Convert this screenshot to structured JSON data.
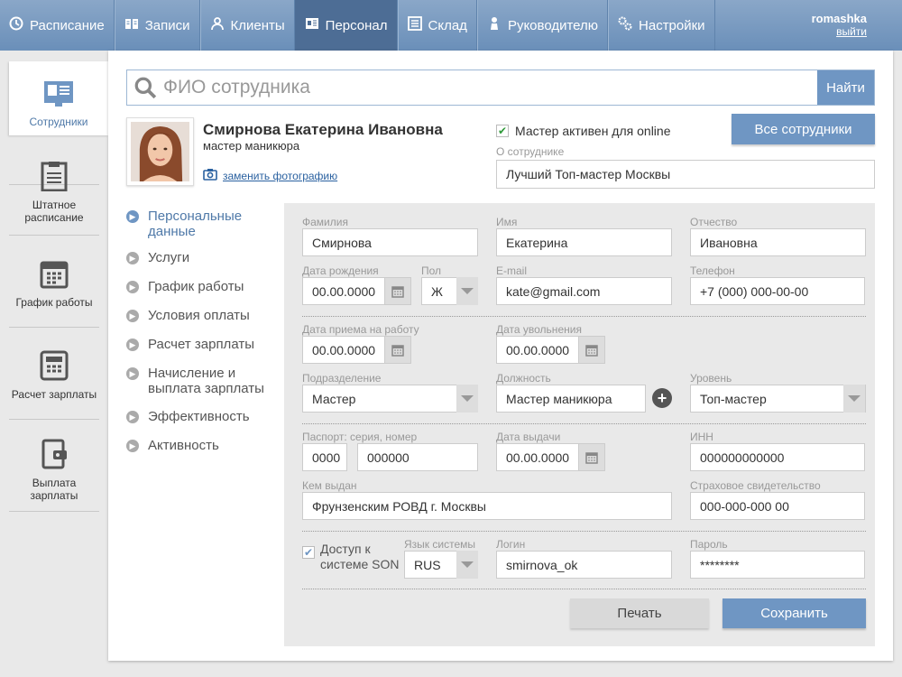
{
  "topnav": {
    "items": [
      {
        "label": "Расписание",
        "icon": "clock-icon"
      },
      {
        "label": "Записи",
        "icon": "book-icon"
      },
      {
        "label": "Клиенты",
        "icon": "users-icon"
      },
      {
        "label": "Персонал",
        "icon": "id-card-icon",
        "active": true
      },
      {
        "label": "Склад",
        "icon": "list-icon"
      },
      {
        "label": "Руководителю",
        "icon": "person-icon"
      },
      {
        "label": "Настройки",
        "icon": "gears-icon"
      }
    ],
    "user": "romashka",
    "logout": "выйти"
  },
  "sidebar": {
    "items": [
      {
        "label": "Сотрудники",
        "icon": "id-card-icon",
        "active": true
      },
      {
        "label": "Штатное расписание",
        "icon": "clipboard-icon"
      },
      {
        "label": "График работы",
        "icon": "calendar-icon"
      },
      {
        "label": "Расчет зарплаты",
        "icon": "calculator-icon"
      },
      {
        "label": "Выплата зарплаты",
        "icon": "wallet-icon"
      }
    ]
  },
  "search": {
    "placeholder": "ФИО сотрудника",
    "button": "Найти"
  },
  "employee": {
    "name": "Смирнова Екатерина Ивановна",
    "role": "мастер маникюра",
    "change_photo": "заменить фотографию",
    "active_online": "Мастер активен для online",
    "all_employees": "Все сотрудники",
    "about_label": "О сотруднике",
    "about": "Лучший Топ-мастер Москвы"
  },
  "submenu": [
    {
      "label": "Персональные данные",
      "active": true
    },
    {
      "label": "Услуги"
    },
    {
      "label": "График работы"
    },
    {
      "label": "Условия оплаты"
    },
    {
      "label": "Расчет зарплаты"
    },
    {
      "label": "Начисление и выплата зарплаты"
    },
    {
      "label": "Эффективность"
    },
    {
      "label": "Активность"
    }
  ],
  "form": {
    "lastname_label": "Фамилия",
    "lastname": "Смирнова",
    "firstname_label": "Имя",
    "firstname": "Екатерина",
    "middlename_label": "Отчество",
    "middlename": "Ивановна",
    "birthdate_label": "Дата рождения",
    "birthdate": "00.00.0000",
    "gender_label": "Пол",
    "gender": "Ж",
    "email_label": "E-mail",
    "email": "kate@gmail.com",
    "phone_label": "Телефон",
    "phone": "+7 (000) 000-00-00",
    "hire_label": "Дата приема на работу",
    "hire": "00.00.0000",
    "fire_label": "Дата увольнения",
    "fire": "00.00.0000",
    "dept_label": "Подразделение",
    "dept": "Мастер",
    "position_label": "Должность",
    "position": "Мастер маникюра",
    "level_label": "Уровень",
    "level": "Топ-мастер",
    "passport_label": "Паспорт: серия, номер",
    "passport_series": "0000",
    "passport_number": "000000",
    "issue_date_label": "Дата выдачи",
    "issue_date": "00.00.0000",
    "inn_label": "ИНН",
    "inn": "000000000000",
    "issued_by_label": "Кем выдан",
    "issued_by": "Фрунзенским РОВД г. Москвы",
    "insurance_label": "Страховое свидетельство",
    "insurance": "000-000-000 00",
    "access_label": "Доступ к системе SON",
    "lang_label": "Язык системы",
    "lang": "RUS",
    "login_label": "Логин",
    "login": "smirnova_ok",
    "password_label": "Пароль",
    "password": "********",
    "print": "Печать",
    "save": "Сохранить"
  }
}
